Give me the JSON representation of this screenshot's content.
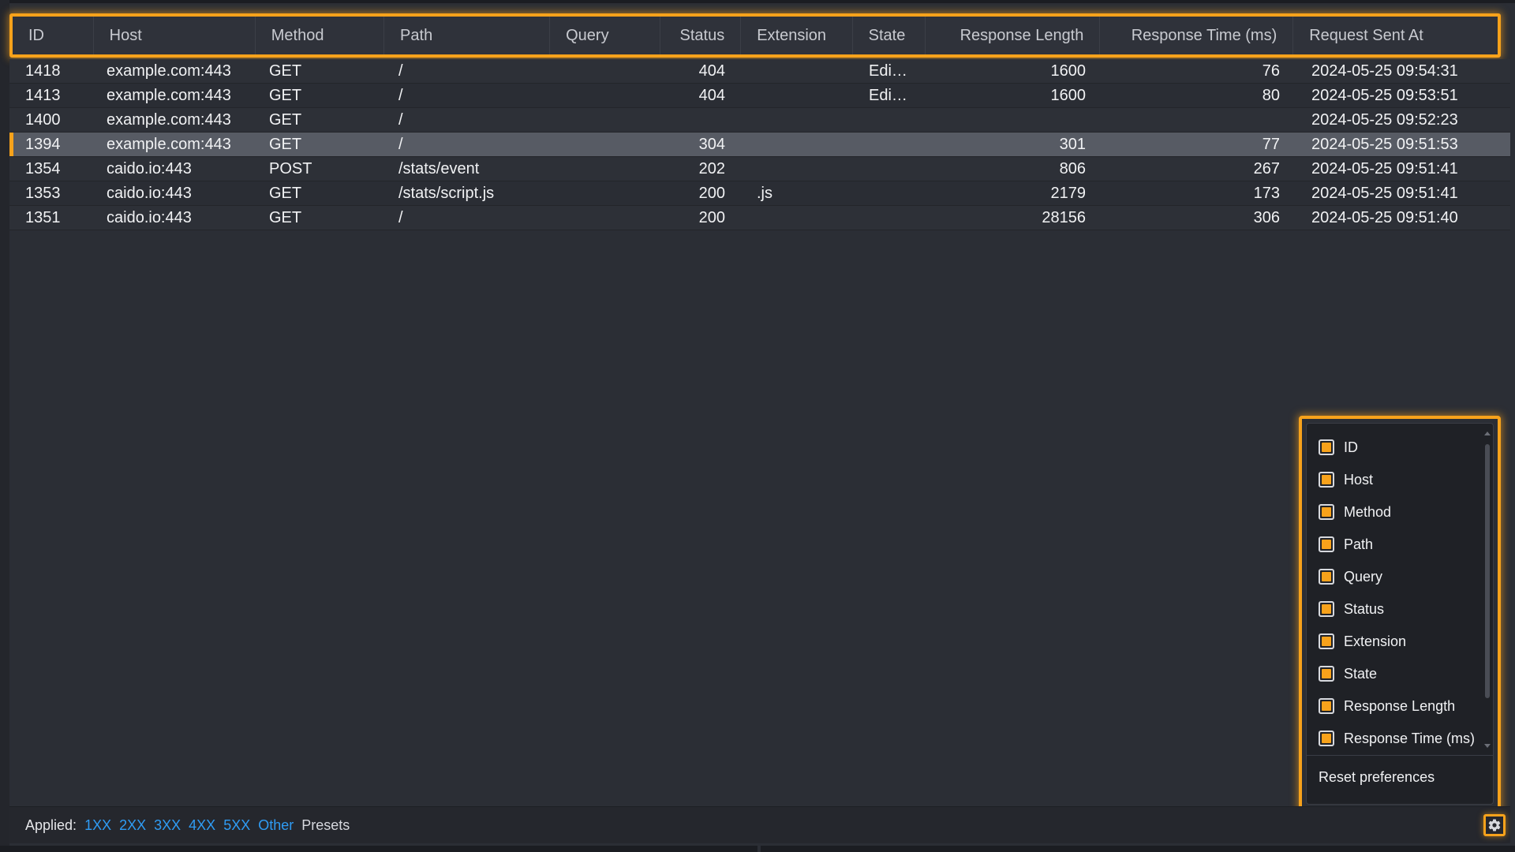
{
  "columns": [
    {
      "label": "ID"
    },
    {
      "label": "Host"
    },
    {
      "label": "Method"
    },
    {
      "label": "Path"
    },
    {
      "label": "Query"
    },
    {
      "label": "Status"
    },
    {
      "label": "Extension"
    },
    {
      "label": "State"
    },
    {
      "label": "Response Length"
    },
    {
      "label": "Response Time (ms)"
    },
    {
      "label": "Request Sent At"
    }
  ],
  "rows": [
    {
      "id": "1418",
      "host": "example.com:443",
      "method": "GET",
      "path": "/",
      "query": "",
      "status": "404",
      "extension": "",
      "state": "Edi…",
      "response_length": "1600",
      "response_time": "76",
      "sent_at": "2024-05-25 09:54:31",
      "selected": false
    },
    {
      "id": "1413",
      "host": "example.com:443",
      "method": "GET",
      "path": "/",
      "query": "",
      "status": "404",
      "extension": "",
      "state": "Edi…",
      "response_length": "1600",
      "response_time": "80",
      "sent_at": "2024-05-25 09:53:51",
      "selected": false
    },
    {
      "id": "1400",
      "host": "example.com:443",
      "method": "GET",
      "path": "/",
      "query": "",
      "status": "",
      "extension": "",
      "state": "",
      "response_length": "",
      "response_time": "",
      "sent_at": "2024-05-25 09:52:23",
      "selected": false
    },
    {
      "id": "1394",
      "host": "example.com:443",
      "method": "GET",
      "path": "/",
      "query": "",
      "status": "304",
      "extension": "",
      "state": "",
      "response_length": "301",
      "response_time": "77",
      "sent_at": "2024-05-25 09:51:53",
      "selected": true
    },
    {
      "id": "1354",
      "host": "caido.io:443",
      "method": "POST",
      "path": "/stats/event",
      "query": "",
      "status": "202",
      "extension": "",
      "state": "",
      "response_length": "806",
      "response_time": "267",
      "sent_at": "2024-05-25 09:51:41",
      "selected": false
    },
    {
      "id": "1353",
      "host": "caido.io:443",
      "method": "GET",
      "path": "/stats/script.js",
      "query": "",
      "status": "200",
      "extension": ".js",
      "state": "",
      "response_length": "2179",
      "response_time": "173",
      "sent_at": "2024-05-25 09:51:41",
      "selected": false
    },
    {
      "id": "1351",
      "host": "caido.io:443",
      "method": "GET",
      "path": "/",
      "query": "",
      "status": "200",
      "extension": "",
      "state": "",
      "response_length": "28156",
      "response_time": "306",
      "sent_at": "2024-05-25 09:51:40",
      "selected": false
    }
  ],
  "footer": {
    "applied_label": "Applied:",
    "filters": [
      "1XX",
      "2XX",
      "3XX",
      "4XX",
      "5XX",
      "Other"
    ],
    "presets_label": "Presets"
  },
  "column_menu": {
    "options": [
      {
        "label": "ID",
        "checked": true
      },
      {
        "label": "Host",
        "checked": true
      },
      {
        "label": "Method",
        "checked": true
      },
      {
        "label": "Path",
        "checked": true
      },
      {
        "label": "Query",
        "checked": true
      },
      {
        "label": "Status",
        "checked": true
      },
      {
        "label": "Extension",
        "checked": true
      },
      {
        "label": "State",
        "checked": true
      },
      {
        "label": "Response Length",
        "checked": true
      },
      {
        "label": "Response Time (ms)",
        "checked": true
      }
    ],
    "reset_label": "Reset preferences"
  },
  "colors": {
    "accent": "#f7a21b",
    "filter_link": "#2f9cf4",
    "background": "#2b2e35",
    "selected_row": "#575b64"
  },
  "icons": {
    "settings": "gear-icon",
    "checkbox": "checkbox-checked-icon"
  }
}
